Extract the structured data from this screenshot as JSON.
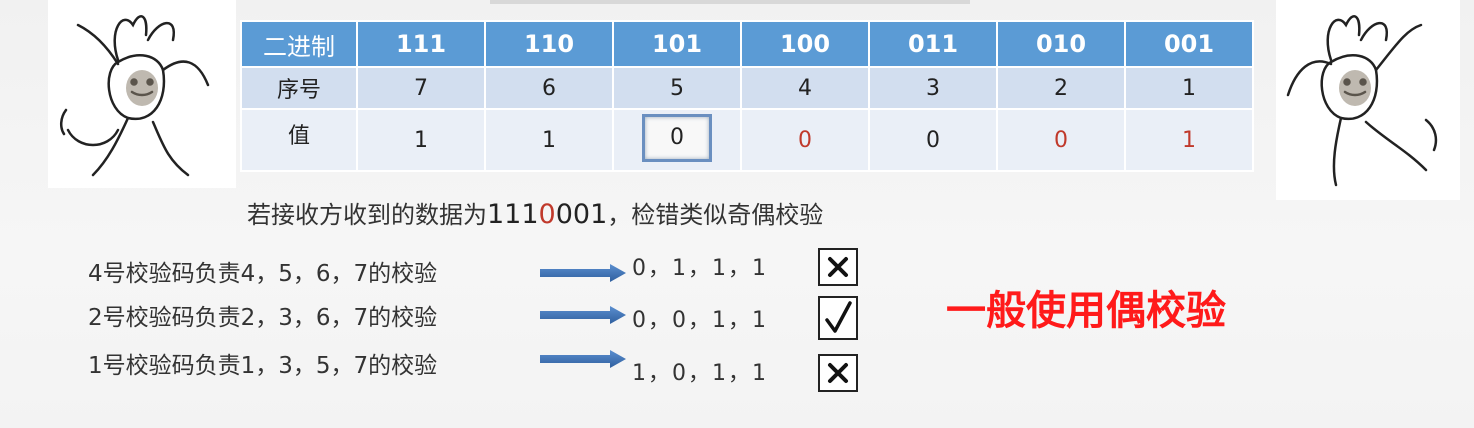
{
  "table": {
    "header": {
      "label": "二进制",
      "cells": [
        "111",
        "110",
        "101",
        "100",
        "011",
        "010",
        "001"
      ]
    },
    "seq": {
      "label": "序号",
      "cells": [
        "7",
        "6",
        "5",
        "4",
        "3",
        "2",
        "1"
      ]
    },
    "value": {
      "label": "值",
      "cells": [
        "1",
        "1",
        "0",
        "0",
        "0",
        "0",
        "1"
      ]
    },
    "highlight_color": "#c0392b",
    "header_color": "#5b9bd5"
  },
  "received": {
    "prefix": "若接收方收到的数据为",
    "data_black": "111",
    "data_red": "0",
    "data_black_tail": "001",
    "suffix": "，检错类似奇偶校验"
  },
  "checks": [
    {
      "text": "4号校验码负责4，5，6，7的校验",
      "result": "0，1，1，1",
      "mark": "cross-icon"
    },
    {
      "text": "2号校验码负责2，3，6，7的校验",
      "result": "0，0，1，1",
      "mark": "check-icon"
    },
    {
      "text": "1号校验码负责1，3，5，7的校验",
      "result": "1，0，1，1",
      "mark": "cross-icon"
    }
  ],
  "note": "一般使用偶校验",
  "note_color": "#ff1a1a"
}
